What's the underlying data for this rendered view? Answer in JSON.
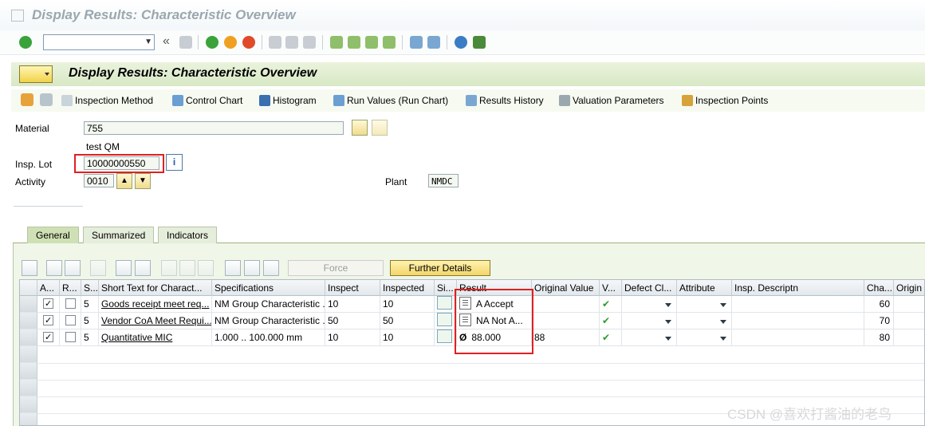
{
  "window": {
    "title": "Display Results: Characteristic Overview"
  },
  "system_toolbar": {
    "command_field_value": "",
    "back_glyph": "«"
  },
  "header": {
    "title": "Display Results: Characteristic Overview"
  },
  "app_toolbar": {
    "buttons": [
      {
        "label": "Inspection Method",
        "icon": "inspection-method-icon"
      },
      {
        "label": "Control Chart",
        "icon": "control-chart-icon"
      },
      {
        "label": "Histogram",
        "icon": "histogram-icon"
      },
      {
        "label": "Run Values (Run Chart)",
        "icon": "run-chart-icon"
      },
      {
        "label": "Results History",
        "icon": "results-history-icon"
      },
      {
        "label": "Valuation Parameters",
        "icon": "valuation-parameters-icon"
      },
      {
        "label": "Inspection Points",
        "icon": "inspection-points-icon"
      }
    ]
  },
  "fields": {
    "material_label": "Material",
    "material_value": "755",
    "material_desc": "test QM",
    "insp_lot_label": "Insp. Lot",
    "insp_lot_value": "10000000550",
    "activity_label": "Activity",
    "activity_value": "0010",
    "plant_label": "Plant",
    "plant_value": "NMDC"
  },
  "tabs": [
    {
      "label": "General",
      "active": true
    },
    {
      "label": "Summarized",
      "active": false
    },
    {
      "label": "Indicators",
      "active": false
    }
  ],
  "table_toolbar": {
    "force_label": "Force",
    "further_details_label": "Further Details"
  },
  "table": {
    "columns": [
      "A...",
      "R...",
      "S...",
      "Short Text for Charact...",
      "Specifications",
      "Inspect",
      "Inspected",
      "Si...",
      "Result",
      "Original Value",
      "V...",
      "Defect Cl...",
      "Attribute",
      "Insp. Descriptn",
      "Cha...",
      "Origin I"
    ],
    "rows": [
      {
        "a": true,
        "r": false,
        "s": "5",
        "short_text": "Goods receipt meet req...",
        "spec": "NM Group Characteristic ...",
        "inspect": "10",
        "inspected": "10",
        "result": "A Accept",
        "original": "",
        "valuation": "✔",
        "cha": "60"
      },
      {
        "a": true,
        "r": false,
        "s": "5",
        "short_text": "Vendor CoA Meet Requi...",
        "spec": "NM Group Characteristic ...",
        "inspect": "50",
        "inspected": "50",
        "result": "NA Not A...",
        "original": "",
        "valuation": "✔",
        "cha": "70"
      },
      {
        "a": true,
        "r": false,
        "s": "5",
        "short_text": "Quantitative MIC",
        "spec": "1.000 .. 100.000 mm",
        "inspect": "10",
        "inspected": "10",
        "result": "88.000",
        "original": "88",
        "valuation": "✔",
        "cha": "80"
      }
    ]
  },
  "watermark": "CSDN @喜欢打酱油的老鸟"
}
